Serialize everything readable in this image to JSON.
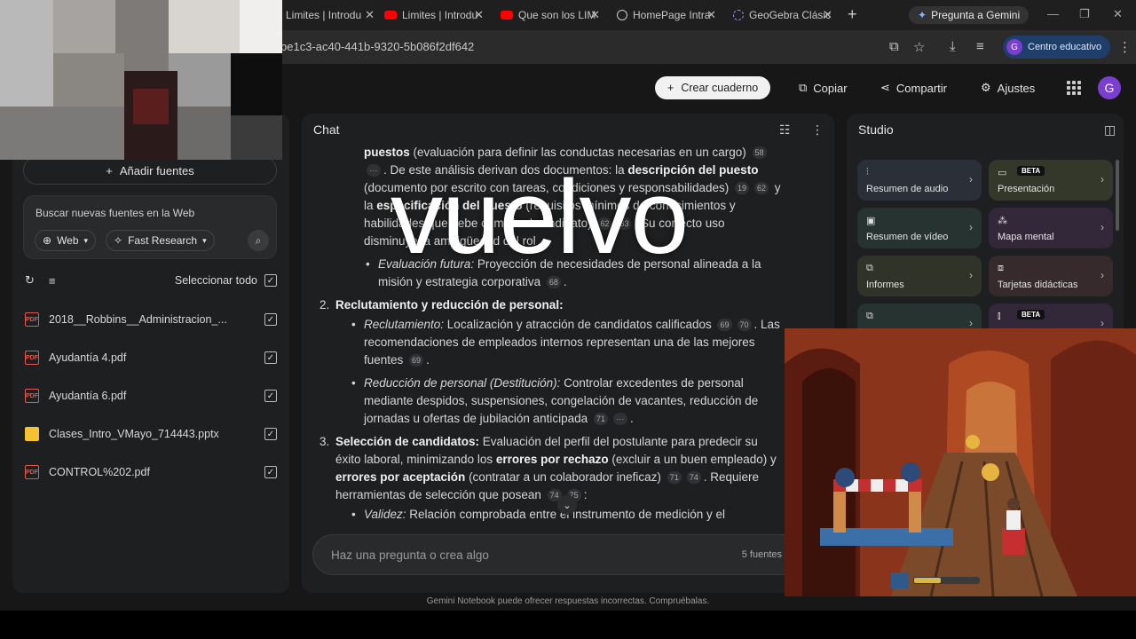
{
  "browser": {
    "tabs": [
      {
        "title": "Limites | Introdu",
        "icon": "youtube-icon"
      },
      {
        "title": "Limites | Introdu",
        "icon": "youtube-icon"
      },
      {
        "title": "Que son los LIM",
        "icon": "youtube-icon"
      },
      {
        "title": "HomePage Intra",
        "icon": "globe-icon"
      },
      {
        "title": "GeoGebra Clásic",
        "icon": "geogebra-icon"
      }
    ],
    "gemini_button": "Pregunta a Gemini",
    "url": "be1c3-ac40-441b-9320-5b086f2df642",
    "profile_label": "Centro educativo",
    "profile_initial": "G",
    "accent_youtube": "#ff0000"
  },
  "header": {
    "create_notebook": "Crear cuaderno",
    "copy": "Copiar",
    "share": "Compartir",
    "settings": "Ajustes",
    "avatar_initial": "G"
  },
  "sources": {
    "add_sources": "Añadir fuentes",
    "web_search_placeholder": "Buscar nuevas fuentes en la Web",
    "web_chip": "Web",
    "fast_research_chip": "Fast Research",
    "select_all": "Seleccionar todo",
    "items": [
      {
        "name": "2018__Robbins__Administracion_...",
        "type": "PDF",
        "checked": true
      },
      {
        "name": "Ayudantía 4.pdf",
        "type": "PDF",
        "checked": true
      },
      {
        "name": "Ayudantía 6.pdf",
        "type": "PDF",
        "checked": true
      },
      {
        "name": "Clases_Intro_VMayo_714443.pptx",
        "type": "PPTX",
        "checked": true
      },
      {
        "name": "CONTROL%202.pdf",
        "type": "PDF",
        "checked": true
      }
    ]
  },
  "chat": {
    "title": "Chat",
    "input_placeholder": "Haz una pregunta o crea algo",
    "source_count": "5 fuentes",
    "footer_note": "Gemini Notebook puede ofrecer respuestas incorrectas. Compruébalas.",
    "content": {
      "p1_a": "puestos",
      "p1_b": " (evaluación para definir las conductas necesarias en un cargo) ",
      "c58": "58",
      "c_dots1": "···",
      "p1_c": ". De este análisis derivan dos documentos: la ",
      "p1_d": "descripción del puesto",
      "p1_e": " (documento por escrito con tareas, condiciones y responsabilidades) ",
      "c19": "19",
      "c62a": "62",
      "p1_f": " y la ",
      "p1_g": "especificación del puesto",
      "p1_h": " (requisitos mínimos de conocimientos y habilidades que debe cumplir el candidato) ",
      "c62b": "62",
      "c63": "63",
      "p1_i": ". Su correcto uso disminuye la ambigüedad del rol",
      "b1_a": "Evaluación futura:",
      "b1_b": " Proyección de necesidades de personal alineada a la misión y estrategia corporativa ",
      "c68": "68",
      "n2": "2.",
      "h2": "Reclutamiento y reducción de personal:",
      "b2_a": "Reclutamiento:",
      "b2_b": " Localización y atracción de candidatos calificados ",
      "c69": "69",
      "c70": "70",
      "b2_c": ". Las recomendaciones de empleados internos representan una de las mejores fuentes ",
      "c69b": "69",
      "b3_a": "Reducción de personal (Destitución):",
      "b3_b": " Controlar excedentes de personal mediante despidos, suspensiones, congelación de vacantes, reducción de jornadas u ofertas de jubilación anticipada ",
      "c71": "71",
      "c_dots2": "···",
      "n3": "3.",
      "h3": "Selección de candidatos:",
      "p3_a": " Evaluación del perfil del postulante para predecir su éxito laboral, minimizando los ",
      "p3_b": "errores por rechazo",
      "p3_c": " (excluir a un buen empleado) y ",
      "p3_d": "errores por aceptación",
      "p3_e": " (contratar a un colaborador ineficaz) ",
      "c71b": "71",
      "c74": "74",
      "p3_f": ". Requiere herramientas de selección que posean ",
      "c74b": "74",
      "c75": "75",
      "b4_a": "Validez:",
      "b4_b": " Relación comprobada entre el instrumento de medición y el"
    }
  },
  "studio": {
    "title": "Studio",
    "tiles": [
      {
        "label": "Resumen de audio",
        "icon": "audio-wave-icon",
        "beta": false
      },
      {
        "label": "Presentación",
        "icon": "slides-icon",
        "beta": true
      },
      {
        "label": "Resumen de vídeo",
        "icon": "video-icon",
        "beta": false
      },
      {
        "label": "Mapa mental",
        "icon": "mind-map-icon",
        "beta": false
      },
      {
        "label": "Informes",
        "icon": "report-icon",
        "beta": false
      },
      {
        "label": "Tarjetas didácticas",
        "icon": "flashcards-icon",
        "beta": false
      }
    ],
    "beta_label": "BETA"
  },
  "overlay": {
    "caption": "vuelvo"
  }
}
